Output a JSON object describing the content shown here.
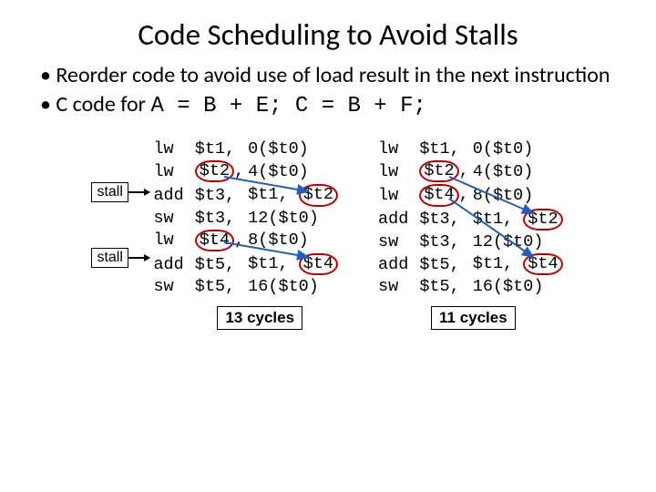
{
  "title": "Code Scheduling to Avoid Stalls",
  "bullets": {
    "b1": "Reorder code to avoid use of load result in the next instruction",
    "b2_prefix": "C code for ",
    "b2_code": "A = B + E; C = B + F;"
  },
  "stall_label": "stall",
  "left": {
    "rows": [
      {
        "op": "lw",
        "a": "$t1,",
        "b": "0($t0)",
        "ring_a": false,
        "ring_b": false
      },
      {
        "op": "lw",
        "a": "$t2,",
        "b": "4($t0)",
        "ring_a": true,
        "ring_b": false
      },
      {
        "op": "add",
        "a": "$t3,",
        "b": "$t1, $t2",
        "ring_a": false,
        "ring_b": true
      },
      {
        "op": "sw",
        "a": "$t3,",
        "b": "12($t0)",
        "ring_a": false,
        "ring_b": false
      },
      {
        "op": "lw",
        "a": "$t4,",
        "b": "8($t0)",
        "ring_a": true,
        "ring_b": false
      },
      {
        "op": "add",
        "a": "$t5,",
        "b": "$t1, $t4",
        "ring_a": false,
        "ring_b": true
      },
      {
        "op": "sw",
        "a": "$t5,",
        "b": "16($t0)",
        "ring_a": false,
        "ring_b": false
      }
    ],
    "cycles": "13 cycles"
  },
  "right": {
    "rows": [
      {
        "op": "lw",
        "a": "$t1,",
        "b": "0($t0)",
        "ring_a": false,
        "ring_b": false
      },
      {
        "op": "lw",
        "a": "$t2,",
        "b": "4($t0)",
        "ring_a": true,
        "ring_b": false
      },
      {
        "op": "lw",
        "a": "$t4,",
        "b": "8($t0)",
        "ring_a": true,
        "ring_b": false
      },
      {
        "op": "add",
        "a": "$t3,",
        "b": "$t1, $t2",
        "ring_a": false,
        "ring_b": true
      },
      {
        "op": "sw",
        "a": "$t3,",
        "b": "12($t0)",
        "ring_a": false,
        "ring_b": false
      },
      {
        "op": "add",
        "a": "$t5,",
        "b": "$t1, $t4",
        "ring_a": false,
        "ring_b": true
      },
      {
        "op": "sw",
        "a": "$t5,",
        "b": "16($t0)",
        "ring_a": false,
        "ring_b": false
      }
    ],
    "cycles": "11 cycles"
  }
}
